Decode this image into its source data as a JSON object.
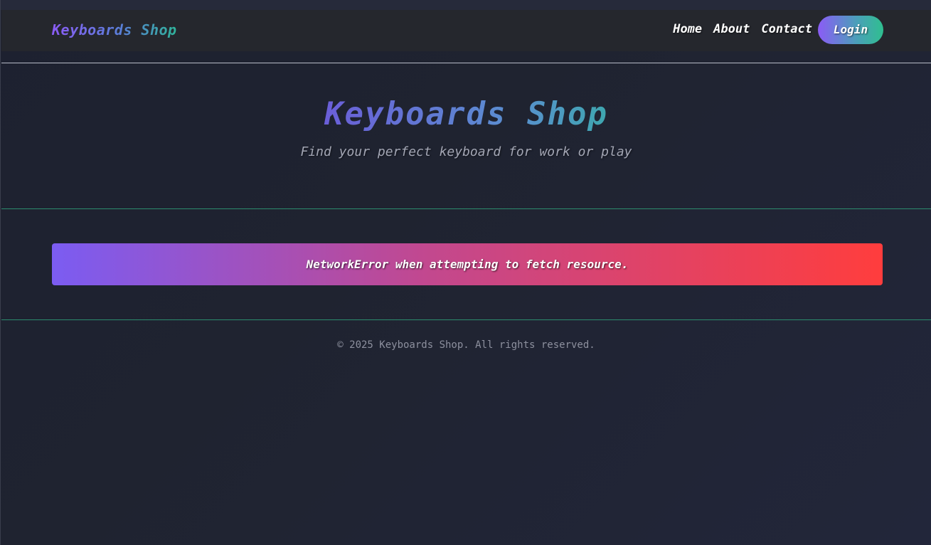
{
  "navbar": {
    "brand": "Keyboards Shop",
    "links": [
      "Home",
      "About",
      "Contact"
    ],
    "login_label": "Login"
  },
  "hero": {
    "title": "Keyboards Shop",
    "subtitle": "Find your perfect keyboard for work or play"
  },
  "error": {
    "message": "NetworkError when attempting to fetch resource."
  },
  "footer": {
    "copyright": "© 2025 Keyboards Shop. All rights reserved."
  },
  "colors": {
    "accent_purple": "#8b5cf6",
    "accent_green": "#2fbf8f",
    "error_red": "#ff3d3d",
    "background": "#1f2330"
  }
}
